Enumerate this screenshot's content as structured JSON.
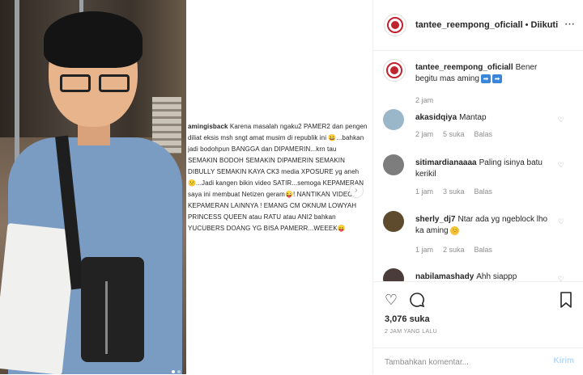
{
  "post": {
    "username": "tantee_reempong_oficiall",
    "separator": "•",
    "follow_label": "Diikuti",
    "more_icon": "more-horizontal-icon"
  },
  "caption": {
    "username": "amingisback",
    "text": "Karena masalah ngaku2 PAMER2 dan pengen diliat eksis msh sngt amat musim di republik ini 😀...bahkan jadi bodohpun BANGGA dan DIPAMERIN...krn tau SEMAKIN BODOH SEMAKIN DIPAMERIN SEMAKIN DIBULLY SEMAKIN KAYA CK3 media XPOSURE yg aneh😕...Jadi  kangen bikin video SATIR...semoga KEPAMERAN saya ini  membuat Netizen geram😜! NANTIKAN VIDEO2 KEPAMERAN LAINNYA ! EMANG CM OKNUM LOWYAH PRINCESS QUEEN atau RATU atau ANI2 bahkan YUCUBERS DOANG YG BISA PAMERR...WEEEK😛"
  },
  "comments": [
    {
      "user": "tantee_reempong_oficiall",
      "text": "Bener begitu mas aming",
      "arrows": [
        "➡",
        "➡"
      ],
      "time": "2 jam",
      "likes": "",
      "reply": "",
      "avatar_color": "#c0242f"
    },
    {
      "user": "akasidqiya",
      "text": "Mantap",
      "time": "2 jam",
      "likes": "5 suka",
      "reply": "Balas",
      "avatar_color": "#9ab6c9"
    },
    {
      "user": "sitimardianaaaa",
      "text": "Paling isinya batu kerikil",
      "time": "1 jam",
      "likes": "3 suka",
      "reply": "Balas",
      "avatar_color": "#7d7d7d"
    },
    {
      "user": "sherly_dj7",
      "text": "Ntar ada yg ngeblock lho ka aming",
      "emoji": "😊",
      "time": "1 jam",
      "likes": "2 suka",
      "reply": "Balas",
      "avatar_color": "#5e4a2c"
    },
    {
      "user": "nabilamashady",
      "text": "Ahh siappp",
      "time": "",
      "likes": "",
      "reply": "",
      "avatar_color": "#4a3c3a"
    }
  ],
  "actions": {
    "like_icon": "heart-icon",
    "comment_icon": "comment-icon",
    "save_icon": "bookmark-icon",
    "likes_count": "3,076 suka",
    "timestamp": "2 JAM YANG LALU"
  },
  "add_comment": {
    "placeholder": "Tambahkan komentar...",
    "post_label": "Kirim"
  }
}
